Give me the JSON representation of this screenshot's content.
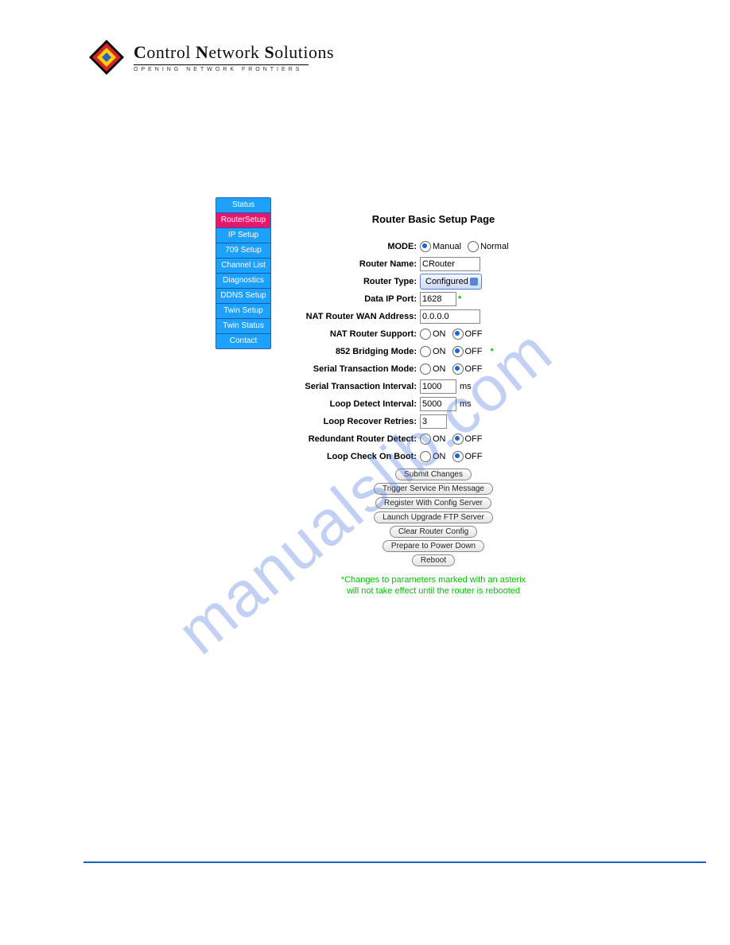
{
  "brand": {
    "title_html": "Control Network Solutions",
    "tagline": "OPENING NETWORK FRONTIERS"
  },
  "sidebar": {
    "items": [
      {
        "label": "Status",
        "active": false
      },
      {
        "label": "RouterSetup",
        "active": true
      },
      {
        "label": "IP Setup",
        "active": false
      },
      {
        "label": "709 Setup",
        "active": false
      },
      {
        "label": "Channel List",
        "active": false
      },
      {
        "label": "Diagnostics",
        "active": false
      },
      {
        "label": "DDNS Setup",
        "active": false
      },
      {
        "label": "Twin Setup",
        "active": false
      },
      {
        "label": "Twin Status",
        "active": false
      },
      {
        "label": "Contact",
        "active": false
      }
    ]
  },
  "page_title": "Router Basic Setup Page",
  "form": {
    "mode_label": "MODE:",
    "mode_manual": "Manual",
    "mode_normal": "Normal",
    "mode_value": "Manual",
    "router_name_label": "Router Name:",
    "router_name": "CRouter",
    "router_type_label": "Router Type:",
    "router_type": "Configured",
    "data_ip_port_label": "Data IP Port:",
    "data_ip_port": "1628",
    "nat_wan_label": "NAT Router WAN Address:",
    "nat_wan": "0.0.0.0",
    "nat_support_label": "NAT Router Support:",
    "nat_support": "OFF",
    "bridge_label": "852 Bridging Mode:",
    "bridge": "OFF",
    "serial_mode_label": "Serial Transaction Mode:",
    "serial_mode": "OFF",
    "serial_interval_label": "Serial Transaction Interval:",
    "serial_interval": "1000",
    "serial_interval_unit": "ms",
    "loop_detect_label": "Loop Detect Interval:",
    "loop_detect": "5000",
    "loop_detect_unit": "ms",
    "loop_recover_label": "Loop Recover Retries:",
    "loop_recover": "3",
    "redundant_label": "Redundant Router Detect:",
    "redundant": "OFF",
    "loop_boot_label": "Loop Check On Boot:",
    "loop_boot": "OFF",
    "on": "ON",
    "off": "OFF"
  },
  "buttons": {
    "submit": "Submit Changes",
    "trigger": "Trigger Service Pin Message",
    "register": "Register With Config Server",
    "launch": "Launch Upgrade FTP Server",
    "clear": "Clear Router Config",
    "prepare": "Prepare to Power Down",
    "reboot": "Reboot"
  },
  "footnote_line1": "*Changes to parameters marked with an asterix",
  "footnote_line2": "will not take effect until the router is rebooted",
  "watermark": "manualslib.com"
}
